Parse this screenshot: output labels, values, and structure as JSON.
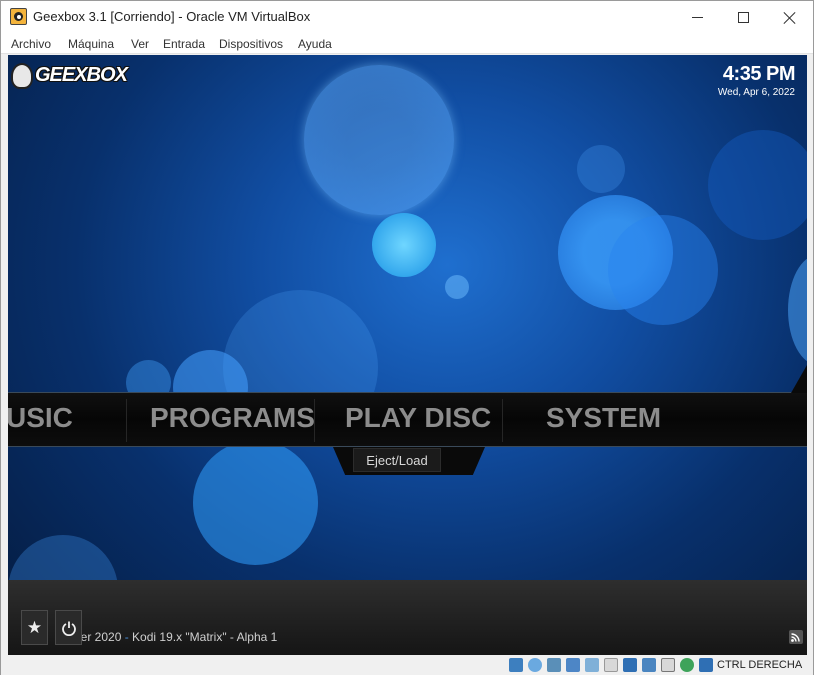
{
  "window": {
    "title": "Geexbox 3.1 [Corriendo] - Oracle VM VirtualBox",
    "minimize_label": "",
    "maximize_label": "",
    "close_label": ""
  },
  "menubar": {
    "items": [
      "Archivo",
      "Máquina",
      "Ver",
      "Entrada",
      "Dispositivos",
      "Ayuda"
    ]
  },
  "guest": {
    "logo_text": "GEEXBOX",
    "clock": {
      "time": "4:35 PM",
      "date": "Wed, Apr 6, 2022"
    },
    "main_menu": [
      "USIC",
      "PROGRAMS",
      "PLAY DISC",
      "SYSTEM"
    ],
    "submenu": [
      "Eject/Load"
    ],
    "footer": {
      "prefix": "ber 2020",
      "separator": " - ",
      "version": "Kodi 19.x \"Matrix\" - Alpha 1"
    },
    "favourites_icon": "star-icon",
    "power_icon": "power-icon",
    "rss_icon": "rss-icon"
  },
  "statusbar": {
    "icons": [
      "hard-disk-icon",
      "optical-drive-icon",
      "audio-icon",
      "network-icon",
      "usb-icon",
      "shared-folders-icon",
      "display-icon",
      "video-capture-icon",
      "virtualization-icon",
      "mouse-integration-icon",
      "keyboard-icon"
    ],
    "host_key_label": "CTRL DERECHA"
  },
  "colors": {
    "accent_separator": "#4a8fd8",
    "menu_text": "#8c8c8c"
  }
}
